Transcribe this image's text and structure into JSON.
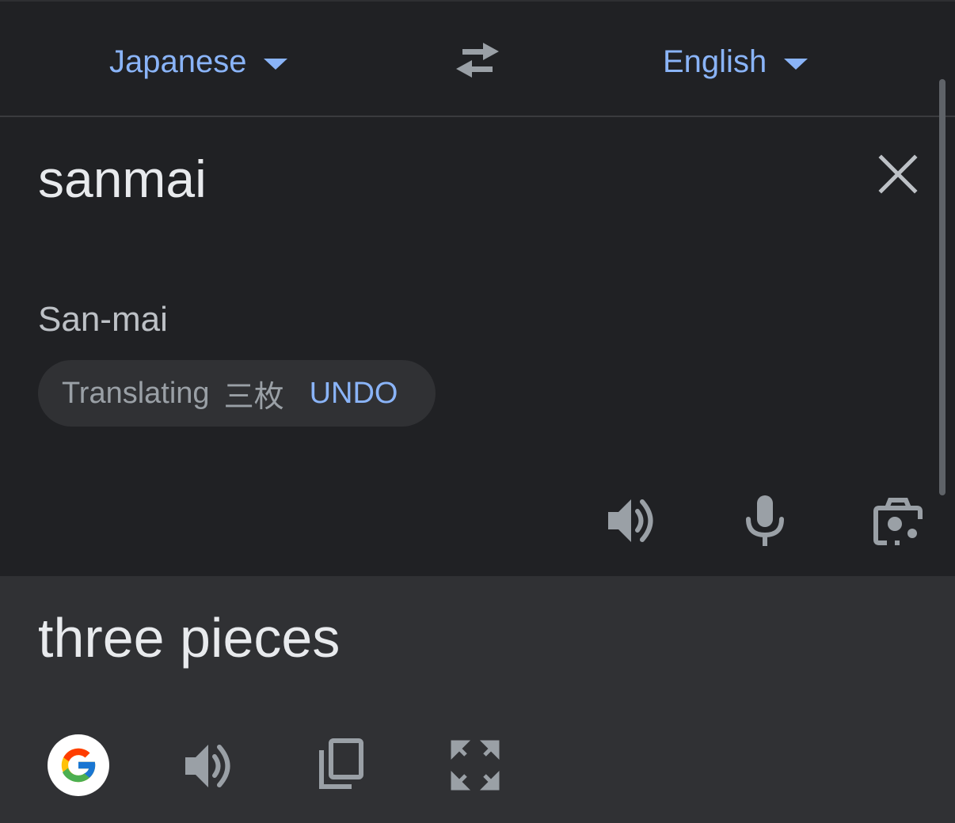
{
  "languages": {
    "source": "Japanese",
    "target": "English"
  },
  "source": {
    "text": "sanmai",
    "transliteration": "San-mai",
    "suggestion": {
      "label": "Translating",
      "term": "三枚",
      "undo": "UNDO"
    }
  },
  "result": {
    "text": "three pieces"
  },
  "icons": {
    "swap": "swap-arrows-icon",
    "clear": "close-icon",
    "speaker": "speaker-icon",
    "mic": "microphone-icon",
    "camera": "camera-icon",
    "google": "google-logo-icon",
    "copy": "copy-icon",
    "fullscreen": "fullscreen-icon"
  },
  "colors": {
    "background": "#202124",
    "result_background": "#303134",
    "accent": "#8ab4f8",
    "text_primary": "#e8eaed",
    "icon": "#9aa0a6"
  }
}
